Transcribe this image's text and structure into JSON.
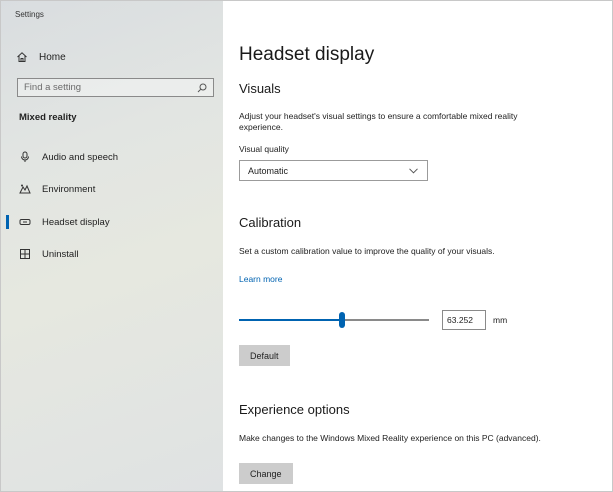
{
  "app": {
    "title": "Settings"
  },
  "sidebar": {
    "home_label": "Home",
    "search_placeholder": "Find a setting",
    "section_title": "Mixed reality",
    "items": [
      {
        "label": "Audio and speech",
        "icon": "microphone-icon",
        "active": false
      },
      {
        "label": "Environment",
        "icon": "environment-icon",
        "active": false
      },
      {
        "label": "Headset display",
        "icon": "headset-icon",
        "active": true
      },
      {
        "label": "Uninstall",
        "icon": "uninstall-icon",
        "active": false
      }
    ]
  },
  "main": {
    "page_title": "Headset display",
    "visuals": {
      "heading": "Visuals",
      "description": "Adjust your headset's visual settings to ensure a comfortable mixed reality experience.",
      "quality_label": "Visual quality",
      "quality_value": "Automatic"
    },
    "calibration": {
      "heading": "Calibration",
      "description": "Set a custom calibration value to improve the quality of your visuals.",
      "learn_more": "Learn more",
      "slider_fraction": 0.54,
      "value": "63.252",
      "unit": "mm",
      "default_button": "Default"
    },
    "experience": {
      "heading": "Experience options",
      "description": "Make changes to the Windows Mixed Reality experience on this PC (advanced).",
      "change_button": "Change"
    }
  },
  "colors": {
    "accent": "#0063b1"
  }
}
